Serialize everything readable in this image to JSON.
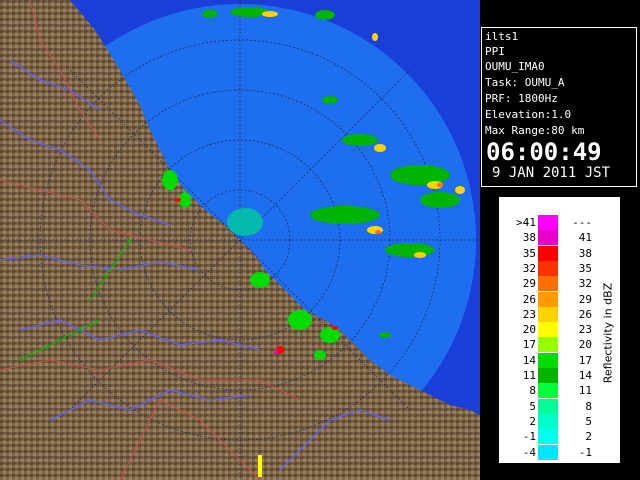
{
  "info": {
    "site": "ilts1",
    "scan_type": "PPI",
    "product": "OUMU_IMA0",
    "task": "Task: OUMU_A",
    "prf": "PRF: 1800Hz",
    "elevation": "Elevation:1.0",
    "max_range": "Max Range:80 km",
    "time": "06:00:49",
    "date": "9 JAN 2011 JST"
  },
  "legend": {
    "unit": "Reflectivity in dBZ",
    "rows": [
      {
        "lo": ">41",
        "hi": "---",
        "color": "#ff00ff"
      },
      {
        "lo": "38",
        "hi": "41",
        "color": "#e600c8"
      },
      {
        "lo": "35",
        "hi": "38",
        "color": "#ff0000"
      },
      {
        "lo": "32",
        "hi": "35",
        "color": "#ff3200"
      },
      {
        "lo": "29",
        "hi": "32",
        "color": "#ff6e00"
      },
      {
        "lo": "26",
        "hi": "29",
        "color": "#ff9b00"
      },
      {
        "lo": "23",
        "hi": "26",
        "color": "#ffd200"
      },
      {
        "lo": "20",
        "hi": "23",
        "color": "#ffff00"
      },
      {
        "lo": "17",
        "hi": "20",
        "color": "#96ff00"
      },
      {
        "lo": "14",
        "hi": "17",
        "color": "#00dc00"
      },
      {
        "lo": "11",
        "hi": "14",
        "color": "#00b400"
      },
      {
        "lo": "8",
        "hi": "11",
        "color": "#00ff3c"
      },
      {
        "lo": "5",
        "hi": "8",
        "color": "#00ff96"
      },
      {
        "lo": "2",
        "hi": "5",
        "color": "#00ffc8"
      },
      {
        "lo": "-1",
        "hi": "2",
        "color": "#00fff0"
      },
      {
        "lo": "-4",
        "hi": "-1",
        "color": "#00e6ff"
      }
    ]
  },
  "colors": {
    "sea_outer": "#1a3fd8",
    "sea_inner": "#1e6ef0",
    "land": "#7a6448",
    "river": "#5a5aff",
    "border": "#c85050"
  }
}
